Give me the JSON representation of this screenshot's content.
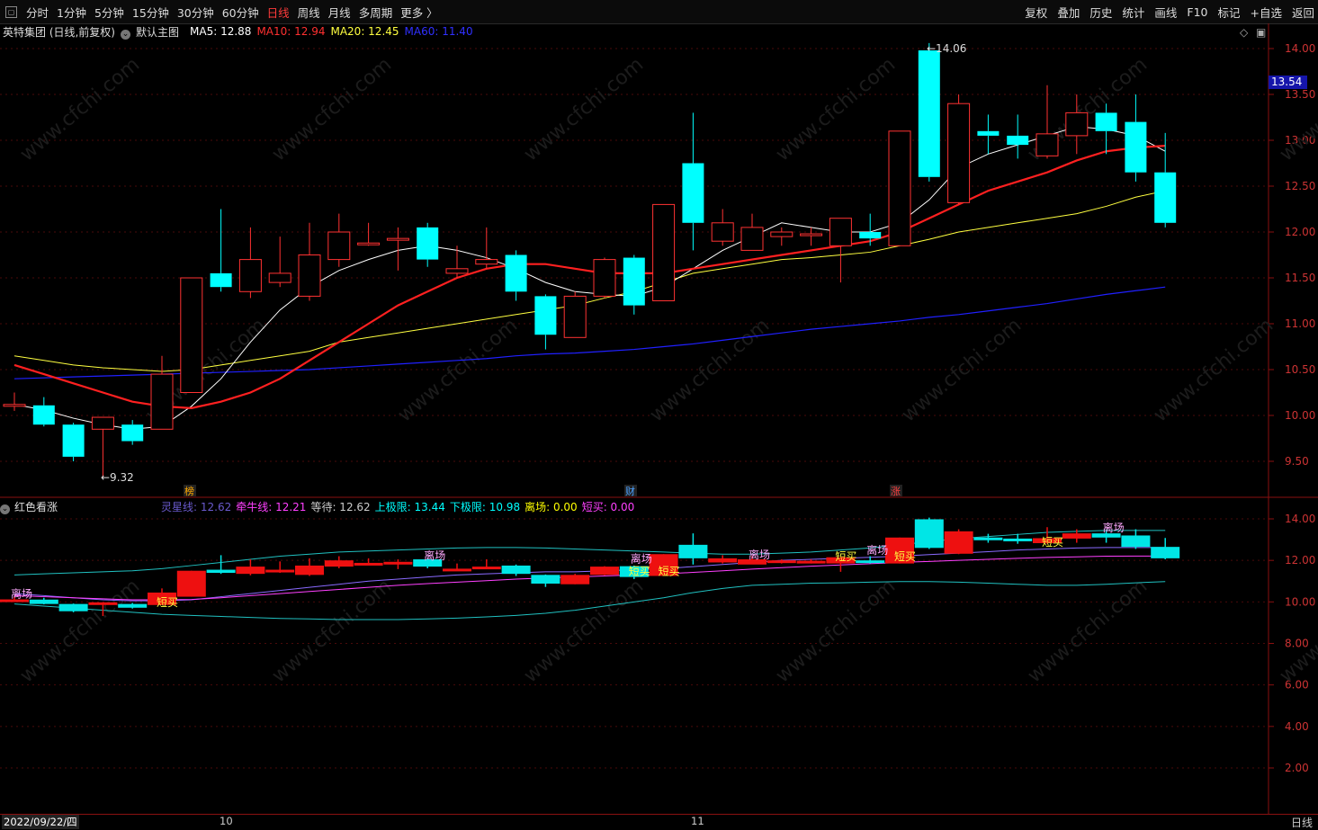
{
  "toolbar": {
    "tabs": [
      "分时",
      "1分钟",
      "5分钟",
      "15分钟",
      "30分钟",
      "60分钟",
      "日线",
      "周线",
      "月线",
      "多周期",
      "更多 〉"
    ],
    "active_tab": "日线",
    "right_buttons": [
      "复权",
      "叠加",
      "历史",
      "统计",
      "画线",
      "F10",
      "标记",
      "+自选",
      "返回"
    ]
  },
  "main_info": {
    "stock": "英特集团 (日线,前复权)",
    "template": "默认主图",
    "ma5": "MA5: 12.88",
    "ma10": "MA10: 12.94",
    "ma20": "MA20: 12.45",
    "ma60": "MA60: 11.40"
  },
  "sub_info": {
    "name": "红色看涨",
    "items": [
      {
        "text": "灵星线: 12.62",
        "color": "#6a5acd"
      },
      {
        "text": "牵牛线: 12.21",
        "color": "#ff40ff"
      },
      {
        "text": "等待: 12.62",
        "color": "#cccccc"
      },
      {
        "text": "上极限: 13.44",
        "color": "#00ffff"
      },
      {
        "text": "下极限: 10.98",
        "color": "#00ffff"
      },
      {
        "text": "离场: 0.00",
        "color": "#ffff00"
      },
      {
        "text": "短买: 0.00",
        "color": "#ff40ff"
      }
    ]
  },
  "markers": {
    "high": "14.06",
    "low": "9.32",
    "bang": "榜",
    "cai": "财",
    "zhang": "涨"
  },
  "current_price": "13.54",
  "axis_main": [
    "14.00",
    "13.50",
    "13.00",
    "12.50",
    "12.00",
    "11.50",
    "11.00",
    "10.50",
    "10.00",
    "9.50"
  ],
  "axis_sub": [
    "14.00",
    "12.00",
    "10.00",
    "8.00",
    "6.00",
    "4.00",
    "2.00"
  ],
  "bottom": {
    "date": "2022/09/22/四",
    "month1": "10",
    "month2": "11",
    "period": "日线"
  },
  "labels": {
    "lichang": "离场",
    "duanmai": "短买"
  },
  "watermark": "www.cfchi.com",
  "colors": {
    "up": "#ff3232",
    "down": "#00ffff",
    "ma5": "#ffffff",
    "ma10": "#ff2020",
    "ma20": "#ffff40",
    "ma60": "#2020ff"
  },
  "chart_data": {
    "type": "candlestick",
    "candles": [
      [
        10.1,
        10.12,
        10.05,
        10.25
      ],
      [
        10.11,
        9.9,
        9.88,
        10.2
      ],
      [
        9.9,
        9.55,
        9.5,
        9.92
      ],
      [
        9.85,
        9.98,
        9.32,
        9.98
      ],
      [
        9.9,
        9.72,
        9.68,
        9.95
      ],
      [
        9.85,
        10.45,
        9.85,
        10.65
      ],
      [
        10.25,
        11.5,
        10.25,
        11.5
      ],
      [
        11.55,
        11.4,
        11.35,
        12.25
      ],
      [
        11.35,
        11.7,
        11.28,
        12.05
      ],
      [
        11.45,
        11.55,
        11.4,
        11.95
      ],
      [
        11.3,
        11.75,
        11.25,
        12.1
      ],
      [
        11.7,
        12.0,
        11.62,
        12.2
      ],
      [
        11.88,
        11.88,
        11.85,
        12.1
      ],
      [
        11.93,
        11.93,
        11.58,
        12.05
      ],
      [
        12.05,
        11.7,
        11.62,
        12.1
      ],
      [
        11.55,
        11.6,
        11.5,
        11.85
      ],
      [
        11.65,
        11.7,
        11.6,
        12.05
      ],
      [
        11.75,
        11.35,
        11.25,
        11.8
      ],
      [
        11.3,
        10.88,
        10.72,
        11.32
      ],
      [
        10.85,
        11.3,
        10.85,
        11.35
      ],
      [
        11.3,
        11.7,
        11.28,
        11.72
      ],
      [
        11.72,
        11.2,
        11.1,
        11.75
      ],
      [
        11.25,
        12.3,
        11.25,
        12.3
      ],
      [
        12.75,
        12.1,
        11.8,
        13.3
      ],
      [
        11.9,
        12.1,
        11.85,
        12.25
      ],
      [
        11.8,
        12.05,
        11.85,
        12.2
      ],
      [
        11.95,
        12.0,
        11.85,
        12.05
      ],
      [
        11.98,
        11.98,
        11.85,
        12.05
      ],
      [
        11.85,
        12.15,
        11.45,
        12.15
      ],
      [
        12.0,
        11.93,
        11.85,
        12.2
      ],
      [
        11.85,
        13.1,
        11.85,
        13.1
      ],
      [
        13.98,
        12.6,
        12.55,
        14.06
      ],
      [
        12.32,
        13.4,
        12.3,
        13.5
      ],
      [
        13.1,
        13.05,
        12.85,
        13.28
      ],
      [
        13.05,
        12.95,
        12.8,
        13.28
      ],
      [
        12.83,
        13.07,
        12.8,
        13.6
      ],
      [
        13.05,
        13.3,
        12.85,
        13.5
      ],
      [
        13.3,
        13.1,
        12.85,
        13.4
      ],
      [
        13.2,
        12.65,
        12.55,
        13.5
      ],
      [
        12.65,
        12.1,
        12.05,
        13.08
      ]
    ],
    "ma5": [
      10.12,
      10.06,
      9.97,
      9.9,
      9.85,
      9.88,
      10.1,
      10.4,
      10.8,
      11.15,
      11.4,
      11.58,
      11.7,
      11.8,
      11.85,
      11.8,
      11.72,
      11.6,
      11.45,
      11.35,
      11.32,
      11.3,
      11.4,
      11.6,
      11.8,
      11.95,
      12.1,
      12.05,
      12.0,
      12.0,
      12.1,
      12.35,
      12.7,
      12.85,
      12.95,
      13.05,
      13.15,
      13.12,
      13.05,
      12.88
    ],
    "ma10": [
      10.55,
      10.45,
      10.35,
      10.25,
      10.15,
      10.1,
      10.08,
      10.15,
      10.25,
      10.4,
      10.6,
      10.8,
      11.0,
      11.2,
      11.35,
      11.5,
      11.6,
      11.65,
      11.65,
      11.6,
      11.55,
      11.55,
      11.55,
      11.6,
      11.65,
      11.7,
      11.75,
      11.8,
      11.85,
      11.9,
      12.0,
      12.15,
      12.3,
      12.45,
      12.55,
      12.65,
      12.78,
      12.88,
      12.92,
      12.94
    ],
    "ma20": [
      10.65,
      10.6,
      10.55,
      10.52,
      10.5,
      10.48,
      10.5,
      10.55,
      10.6,
      10.65,
      10.7,
      10.8,
      10.85,
      10.9,
      10.95,
      11.0,
      11.05,
      11.1,
      11.15,
      11.2,
      11.28,
      11.35,
      11.45,
      11.55,
      11.6,
      11.65,
      11.7,
      11.72,
      11.75,
      11.78,
      11.85,
      11.92,
      12.0,
      12.05,
      12.1,
      12.15,
      12.2,
      12.28,
      12.38,
      12.45
    ],
    "ma60": [
      10.4,
      10.41,
      10.42,
      10.43,
      10.44,
      10.45,
      10.46,
      10.47,
      10.48,
      10.49,
      10.5,
      10.52,
      10.54,
      10.56,
      10.58,
      10.6,
      10.62,
      10.65,
      10.67,
      10.68,
      10.7,
      10.72,
      10.75,
      10.78,
      10.82,
      10.86,
      10.9,
      10.94,
      10.97,
      11.0,
      11.03,
      11.07,
      11.1,
      11.14,
      11.18,
      11.22,
      11.27,
      11.32,
      11.36,
      11.4
    ],
    "upper": [
      11.3,
      11.35,
      11.4,
      11.45,
      11.5,
      11.6,
      11.75,
      11.9,
      12.05,
      12.2,
      12.3,
      12.4,
      12.45,
      12.5,
      12.55,
      12.6,
      12.62,
      12.62,
      12.6,
      12.55,
      12.5,
      12.45,
      12.4,
      12.35,
      12.3,
      12.3,
      12.35,
      12.4,
      12.5,
      12.6,
      12.75,
      12.9,
      13.05,
      13.15,
      13.25,
      13.35,
      13.4,
      13.44,
      13.44,
      13.44
    ],
    "lower": [
      9.9,
      9.8,
      9.7,
      9.6,
      9.5,
      9.4,
      9.35,
      9.3,
      9.25,
      9.2,
      9.18,
      9.15,
      9.15,
      9.15,
      9.18,
      9.22,
      9.28,
      9.35,
      9.45,
      9.6,
      9.8,
      10.0,
      10.2,
      10.45,
      10.65,
      10.8,
      10.85,
      10.9,
      10.92,
      10.95,
      10.98,
      10.98,
      10.95,
      10.9,
      10.85,
      10.8,
      10.8,
      10.85,
      10.92,
      10.98
    ],
    "linghang": [
      10.4,
      10.3,
      10.2,
      10.1,
      10.05,
      10.05,
      10.1,
      10.25,
      10.4,
      10.55,
      10.7,
      10.85,
      11.0,
      11.1,
      11.2,
      11.3,
      11.35,
      11.4,
      11.45,
      11.45,
      11.5,
      11.55,
      11.6,
      11.7,
      11.8,
      11.9,
      12.0,
      12.05,
      12.1,
      12.15,
      12.2,
      12.28,
      12.35,
      12.42,
      12.5,
      12.55,
      12.6,
      12.62,
      12.62,
      12.62
    ],
    "qianniu": [
      10.3,
      10.25,
      10.2,
      10.15,
      10.1,
      10.1,
      10.12,
      10.2,
      10.3,
      10.4,
      10.5,
      10.6,
      10.7,
      10.8,
      10.88,
      10.95,
      11.02,
      11.1,
      11.15,
      11.2,
      11.25,
      11.3,
      11.35,
      11.42,
      11.5,
      11.58,
      11.65,
      11.72,
      11.78,
      11.84,
      11.9,
      11.95,
      12.0,
      12.05,
      12.1,
      12.14,
      12.17,
      12.2,
      12.21,
      12.21
    ]
  }
}
